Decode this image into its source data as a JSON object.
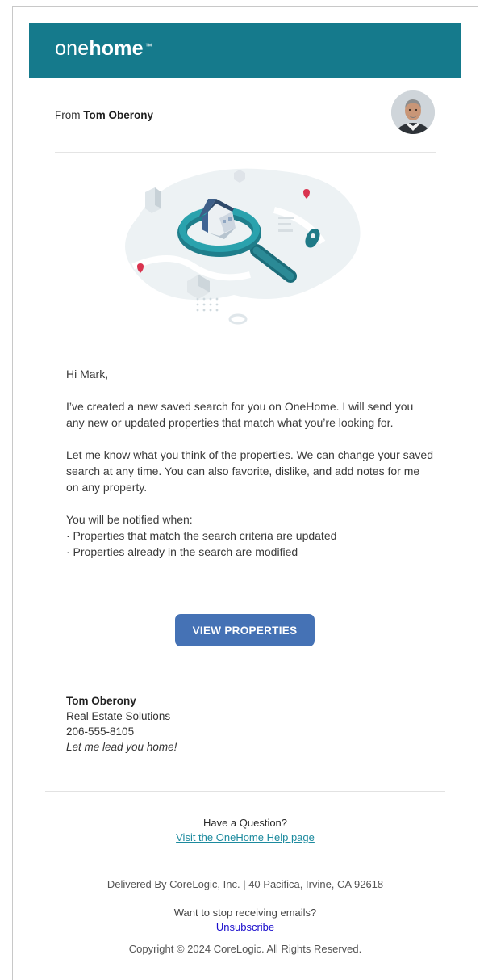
{
  "colors": {
    "brand": "#157a8c",
    "cta": "#4572b5",
    "link": "#1c8a9e"
  },
  "header": {
    "logo_light": "one",
    "logo_bold": "home",
    "logo_mark": "™"
  },
  "sender": {
    "from_label": "From",
    "name": "Tom Oberony"
  },
  "message": {
    "greeting": "Hi Mark,",
    "paragraph1": "I’ve created a new saved search for you on OneHome. I will send you any new or updated properties that match what you’re looking for.",
    "paragraph2": "Let me know what you think of the properties. We can change your saved search at any time. You can also favorite, dislike, and add notes for me on any property.",
    "notify_intro": "You will be notified when:",
    "notify_items": [
      "· Properties that match the search criteria are updated",
      "· Properties already in the search are modified"
    ]
  },
  "cta": {
    "label": "VIEW PROPERTIES"
  },
  "signature": {
    "name": "Tom Oberony",
    "company": "Real Estate Solutions",
    "phone": "206-555-8105",
    "tagline": "Let me lead you home!"
  },
  "footer": {
    "question": "Have a Question?",
    "help_link": "Visit the OneHome Help page",
    "delivered": "Delivered By CoreLogic, Inc. | 40 Pacifica, Irvine, CA 92618",
    "stop_text": "Want to stop receiving emails?",
    "unsubscribe": "Unsubscribe",
    "copyright": "Copyright © 2024 CoreLogic. All Rights Reserved."
  },
  "icons": {
    "avatar": "agent-avatar-photo",
    "illustration": "house-magnifier-illustration"
  }
}
